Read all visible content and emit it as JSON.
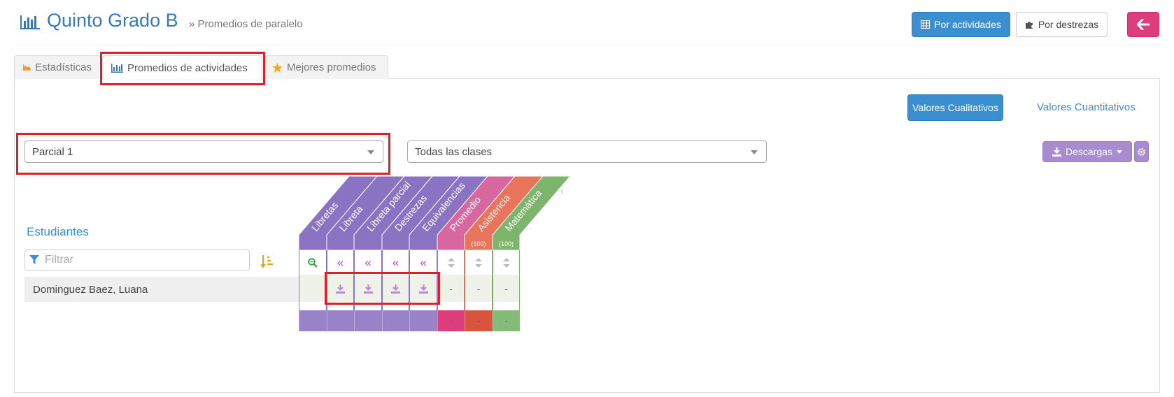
{
  "header": {
    "title": "Quinto Grado B",
    "subtitle": "» Promedios de paralelo",
    "btn_activities": "Por actividades",
    "btn_skills": "Por destrezas"
  },
  "tabs": [
    {
      "label": "Estadísticas",
      "icon": "area-chart-icon"
    },
    {
      "label": "Promedios de actividades",
      "icon": "bar-chart-icon"
    },
    {
      "label": "Mejores promedios",
      "icon": "star-icon"
    }
  ],
  "values_toggle": {
    "qualitative": "Valores Cualitativos",
    "quantitative": "Valores Cuantitativos"
  },
  "filters": {
    "period": "Parcial 1",
    "classes": "Todas las clases"
  },
  "downloads_label": "Descargas",
  "students_heading": "Estudiantes",
  "filter_placeholder": "Filtrar",
  "student": "Dominguez Baez, Luana",
  "columns": [
    {
      "label": "Libretas",
      "sublabel": "",
      "color": "#8a73c2"
    },
    {
      "label": "Libreta",
      "sublabel": "",
      "color": "#8a73c2"
    },
    {
      "label": "Libreta parcial",
      "sublabel": "",
      "color": "#8a73c2"
    },
    {
      "label": "Destrezas",
      "sublabel": "",
      "color": "#8a73c2"
    },
    {
      "label": "Equivalencias",
      "sublabel": "",
      "color": "#8a73c2"
    },
    {
      "label": "Promedio",
      "sublabel": "",
      "color": "#d9679f"
    },
    {
      "label": "Asistencia",
      "sublabel": "(100)",
      "color": "#e8745b"
    },
    {
      "label": "Matemática",
      "sublabel": "(100)",
      "color": "#7cb56b"
    }
  ],
  "row_values": [
    "",
    "",
    "",
    "",
    "",
    "-",
    "-",
    "-"
  ],
  "footer_values": [
    "",
    "",
    "",
    "",
    "",
    "-",
    "-",
    "-"
  ],
  "colors": {
    "primary": "#3a8fd1",
    "pink": "#de3d7d",
    "purple": "#8a73c2",
    "highlight": "#e01e24"
  }
}
